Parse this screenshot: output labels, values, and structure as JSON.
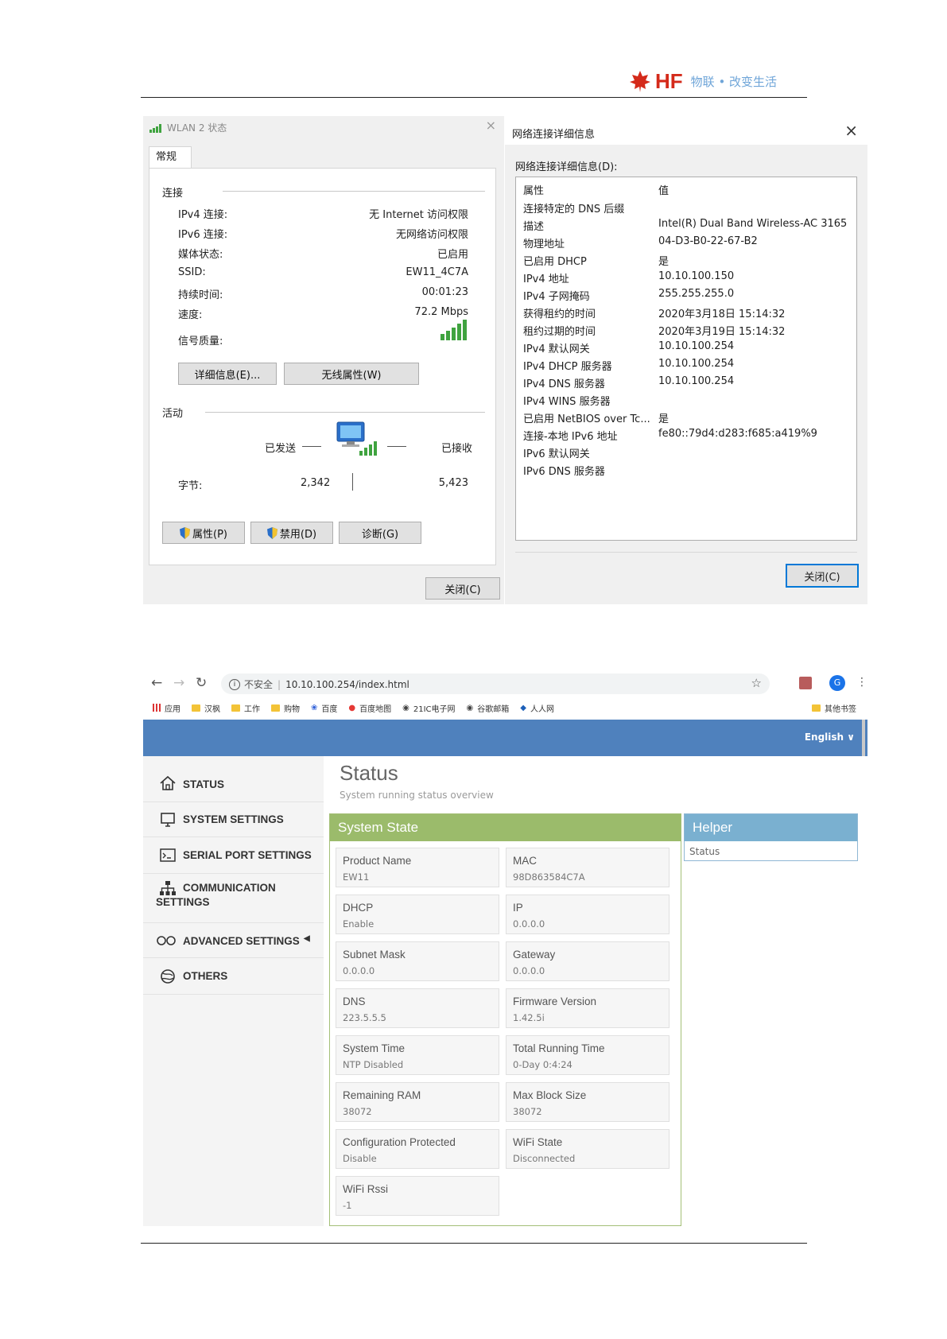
{
  "header": {
    "logo_text": "HF",
    "tagline": "物联 • 改变生活"
  },
  "wlan_status": {
    "title": "WLAN 2 状态",
    "tab": "常规",
    "connection_section": "连接",
    "rows": [
      {
        "label": "IPv4 连接:",
        "value": "无 Internet 访问权限"
      },
      {
        "label": "IPv6 连接:",
        "value": "无网络访问权限"
      },
      {
        "label": "媒体状态:",
        "value": "已启用"
      },
      {
        "label": "SSID:",
        "value": "EW11_4C7A"
      },
      {
        "label": "持续时间:",
        "value": "00:01:23"
      },
      {
        "label": "速度:",
        "value": "72.2 Mbps"
      }
    ],
    "signal_label": "信号质量:",
    "details_button": "详细信息(E)...",
    "wireless_props_button": "无线属性(W)",
    "activity_section": "活动",
    "sent_label": "已发送",
    "received_label": "已接收",
    "bytes_label": "字节:",
    "bytes_sent": "2,342",
    "bytes_received": "5,423",
    "properties_button": "属性(P)",
    "disable_button": "禁用(D)",
    "diagnose_button": "诊断(G)",
    "close_button": "关闭(C)"
  },
  "details_dialog": {
    "title": "网络连接详细信息",
    "list_label": "网络连接详细信息(D):",
    "col_property": "属性",
    "col_value": "值",
    "rows": [
      {
        "p": "连接特定的 DNS 后缀",
        "v": ""
      },
      {
        "p": "描述",
        "v": "Intel(R) Dual Band Wireless-AC 3165"
      },
      {
        "p": "物理地址",
        "v": "04-D3-B0-22-67-B2"
      },
      {
        "p": "已启用 DHCP",
        "v": "是"
      },
      {
        "p": "IPv4 地址",
        "v": "10.10.100.150"
      },
      {
        "p": "IPv4 子网掩码",
        "v": "255.255.255.0"
      },
      {
        "p": "获得租约的时间",
        "v": "2020年3月18日 15:14:32"
      },
      {
        "p": "租约过期的时间",
        "v": "2020年3月19日 15:14:32"
      },
      {
        "p": "IPv4 默认网关",
        "v": "10.10.100.254"
      },
      {
        "p": "IPv4 DHCP 服务器",
        "v": "10.10.100.254"
      },
      {
        "p": "IPv4 DNS 服务器",
        "v": "10.10.100.254"
      },
      {
        "p": "IPv4 WINS 服务器",
        "v": ""
      },
      {
        "p": "已启用 NetBIOS over Tc...",
        "v": "是"
      },
      {
        "p": "连接-本地 IPv6 地址",
        "v": "fe80::79d4:d283:f685:a419%9"
      },
      {
        "p": "IPv6 默认网关",
        "v": ""
      },
      {
        "p": "IPv6 DNS 服务器",
        "v": ""
      }
    ],
    "close_button": "关闭(C)"
  },
  "browser": {
    "security_text": "不安全",
    "url": "10.10.100.254/index.html",
    "profile_letter": "G",
    "bookmarks": [
      "应用",
      "汉枫",
      "工作",
      "购物",
      "百度",
      "百度地图",
      "21IC电子网",
      "谷歌邮箱",
      "人人网"
    ],
    "other_bookmarks": "其他书签",
    "language": "English ∨",
    "menu": [
      {
        "label": "STATUS",
        "icon": "home-icon"
      },
      {
        "label": "SYSTEM SETTINGS",
        "icon": "monitor-icon"
      },
      {
        "label": "SERIAL PORT SETTINGS",
        "icon": "terminal-icon"
      },
      {
        "label": "COMMUNICATION",
        "label2": "SETTINGS",
        "icon": "network-icon"
      },
      {
        "label": "ADVANCED SETTINGS",
        "icon": "infinity-icon"
      },
      {
        "label": "OTHERS",
        "icon": "globe-icon"
      }
    ],
    "page_title": "Status",
    "page_subtitle": "System running status overview",
    "system_state_title": "System State",
    "cells": [
      {
        "k": "Product Name",
        "v": "EW11"
      },
      {
        "k": "MAC",
        "v": "98D863584C7A"
      },
      {
        "k": "DHCP",
        "v": "Enable"
      },
      {
        "k": "IP",
        "v": "0.0.0.0"
      },
      {
        "k": "Subnet Mask",
        "v": "0.0.0.0"
      },
      {
        "k": "Gateway",
        "v": "0.0.0.0"
      },
      {
        "k": "DNS",
        "v": "223.5.5.5"
      },
      {
        "k": "Firmware Version",
        "v": "1.42.5i"
      },
      {
        "k": "System Time",
        "v": "NTP Disabled"
      },
      {
        "k": "Total Running Time",
        "v": "0-Day 0:4:24"
      },
      {
        "k": "Remaining RAM",
        "v": "38072"
      },
      {
        "k": "Max Block Size",
        "v": "38072"
      },
      {
        "k": "Configuration Protected",
        "v": "Disable"
      },
      {
        "k": "WiFi State",
        "v": "Disconnected"
      },
      {
        "k": "WiFi Rssi",
        "v": "-1"
      }
    ],
    "helper_title": "Helper",
    "helper_text": "Status"
  }
}
